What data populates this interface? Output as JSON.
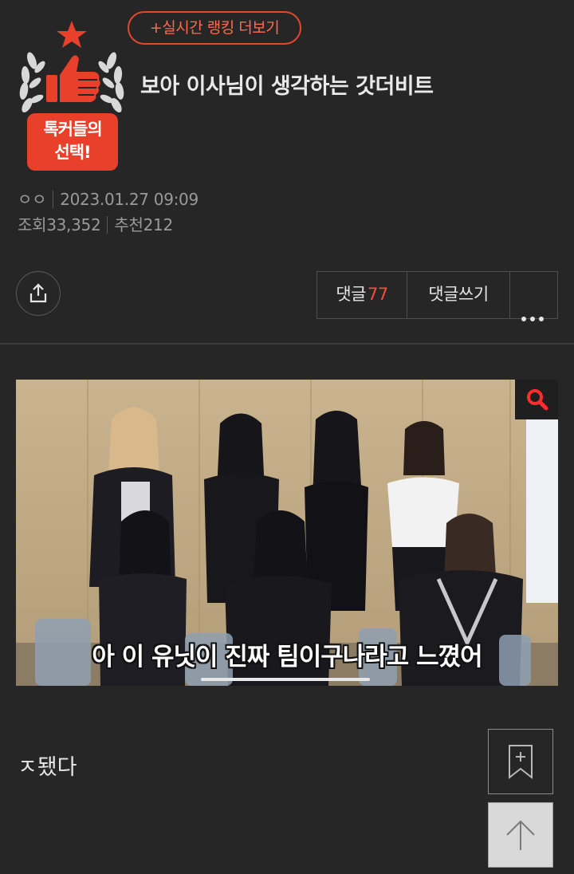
{
  "header": {
    "ranking_button_label": "+실시간 랭킹 더보기",
    "badge_line1": "톡커들의",
    "badge_line2": "선택!",
    "title": "보아 이사님이 생각하는 갓더비트"
  },
  "meta": {
    "author": "ㅇㅇ",
    "datetime": "2023.01.27 09:09",
    "views_label": "조회",
    "views": "33,352",
    "recommend_label": "추천",
    "recommends": "212"
  },
  "actions": {
    "comments_label": "댓글",
    "comments_count": "77",
    "write_comment_label": "댓글쓰기"
  },
  "photo": {
    "caption": "아 이 유닛이 진짜 팀이구나라고 느꼈어"
  },
  "body": {
    "text": "ㅈ됐다"
  },
  "colors": {
    "accent": "#e5462e",
    "background": "#262626",
    "count_red": "#ff4b3a"
  },
  "icons": {
    "badge": "thumbs-up-laurel-icon",
    "share": "share-icon",
    "more": "more-dots-icon",
    "zoom": "search-icon",
    "bookmark": "bookmark-plus-icon",
    "top": "arrow-up-icon"
  }
}
